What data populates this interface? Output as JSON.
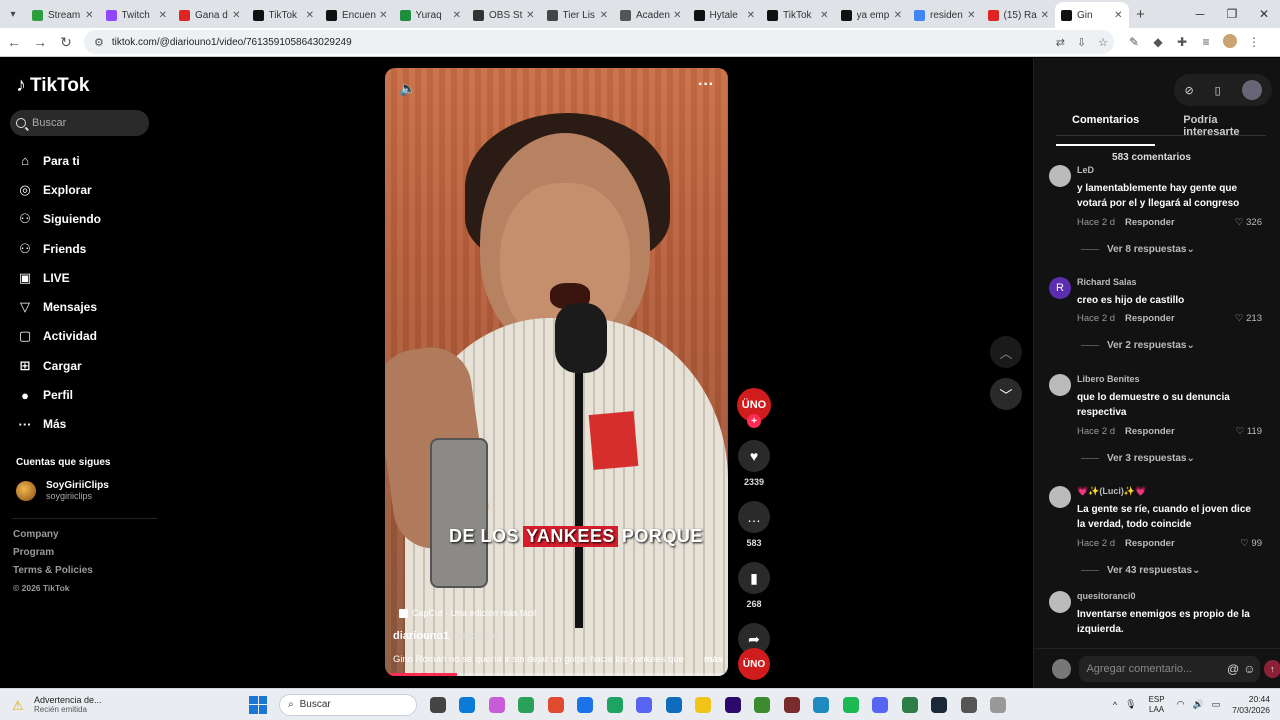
{
  "browser": {
    "tabs": [
      {
        "title": "Stream",
        "color": "#2d9e3e"
      },
      {
        "title": "Twitch",
        "color": "#9146ff"
      },
      {
        "title": "Gana d",
        "color": "#e02424"
      },
      {
        "title": "TikTok",
        "color": "#111111"
      },
      {
        "title": "Encuen",
        "color": "#111111"
      },
      {
        "title": "Yuraq",
        "color": "#1e8e3e"
      },
      {
        "title": "OBS St",
        "color": "#333333"
      },
      {
        "title": "Tier Lis",
        "color": "#444444"
      },
      {
        "title": "Acaden",
        "color": "#555555"
      },
      {
        "title": "Hytale",
        "color": "#111111"
      },
      {
        "title": "TikTok",
        "color": "#111111"
      },
      {
        "title": "ya emp",
        "color": "#111111"
      },
      {
        "title": "residen",
        "color": "#4285f4"
      },
      {
        "title": "(15) Ra",
        "color": "#e02424"
      },
      {
        "title": "Gin",
        "color": "#111111",
        "active": true
      }
    ],
    "new_tab": "+",
    "url": "tiktok.com/@diariouno1/video/7613591058643029249"
  },
  "sidebar": {
    "logo": "TikTok",
    "search_placeholder": "Buscar",
    "nav": [
      {
        "label": "Para ti",
        "icon": "home-icon",
        "glyph": "⌂"
      },
      {
        "label": "Explorar",
        "icon": "compass-icon",
        "glyph": "◎"
      },
      {
        "label": "Siguiendo",
        "icon": "following-icon",
        "glyph": "⚇"
      },
      {
        "label": "Friends",
        "icon": "friends-icon",
        "glyph": "⚇"
      },
      {
        "label": "LIVE",
        "icon": "live-icon",
        "glyph": "▣"
      },
      {
        "label": "Mensajes",
        "icon": "messages-icon",
        "glyph": "▽"
      },
      {
        "label": "Actividad",
        "icon": "activity-icon",
        "glyph": "▢"
      },
      {
        "label": "Cargar",
        "icon": "upload-icon",
        "glyph": "⊞"
      },
      {
        "label": "Perfil",
        "icon": "profile-icon",
        "glyph": "●"
      },
      {
        "label": "Más",
        "icon": "more-icon",
        "glyph": "···"
      }
    ],
    "following_title": "Cuentas que sigues",
    "following": [
      {
        "name": "SoyGiriiClips",
        "handle": "soygiriiclips"
      }
    ],
    "footer": [
      "Company",
      "Program",
      "Terms & Policies"
    ],
    "copyright": "© 2026 TikTok"
  },
  "video": {
    "caption_pre": "DE LOS",
    "caption_hl": "YANKEES",
    "caption_post": "PORQUE",
    "capcut": "CapCut · Una edición más fácil",
    "author": "diariouno1",
    "ago": " · Hace 2 d",
    "description": "Gino Román no se quería ir sin dejar un golpe hacia los yankees que",
    "more": "más",
    "progress": 0.21
  },
  "actions": {
    "avatar_label": "ÜNO",
    "likes": "2339",
    "comments": "583",
    "saves": "268",
    "shares": "597"
  },
  "panel": {
    "tab_comments": "Comentarios",
    "tab_interest": "Podría interesarte",
    "count": "583 comentarios",
    "reply_label": "Responder",
    "comments": [
      {
        "user": "LeD",
        "text": "y lamentablemente hay gente que votará por el y llegará al congreso",
        "ago": "Hace 2 d",
        "likes": "326",
        "more": "Ver 8 respuestas"
      },
      {
        "user": "Richard Salas",
        "text": "creo es hijo de castillo",
        "ago": "Hace 2 d",
        "likes": "213",
        "more": "Ver 2 respuestas",
        "initial": "R"
      },
      {
        "user": "Libero Benites",
        "text": "que lo demuestre o su denuncia respectiva",
        "ago": "Hace 2 d",
        "likes": "119",
        "more": "Ver 3 respuestas"
      },
      {
        "user": "💗✨(Luci)✨💗",
        "text": "La gente se ríe, cuando el joven dice la verdad, todo coincide",
        "ago": "Hace 2 d",
        "likes": "99",
        "more": "Ver 43 respuestas"
      },
      {
        "user": "quesitoranci0",
        "text": "Inventarse enemigos es propio de la izquierda."
      }
    ],
    "add_placeholder": "Agregar comentario..."
  },
  "taskbar": {
    "warning_title": "Advertencia de...",
    "warning_sub": "Recién emitida",
    "search": "Buscar",
    "lang1": "ESP",
    "lang2": "LAA",
    "time": "20:44",
    "date": "7/03/2026",
    "app_colors": [
      "#444",
      "#0a7cd8",
      "#c85bd6",
      "#2aa15a",
      "#e04a2f",
      "#1a73e8",
      "#1ea362",
      "#5865f2",
      "#0f6cbd",
      "#f0c419",
      "#2b0a6b",
      "#3d8b2f",
      "#7a2c2c",
      "#1f8ac0",
      "#1db954",
      "#5865f2",
      "#2d7d46",
      "#1b2838",
      "#555",
      "#999"
    ]
  }
}
